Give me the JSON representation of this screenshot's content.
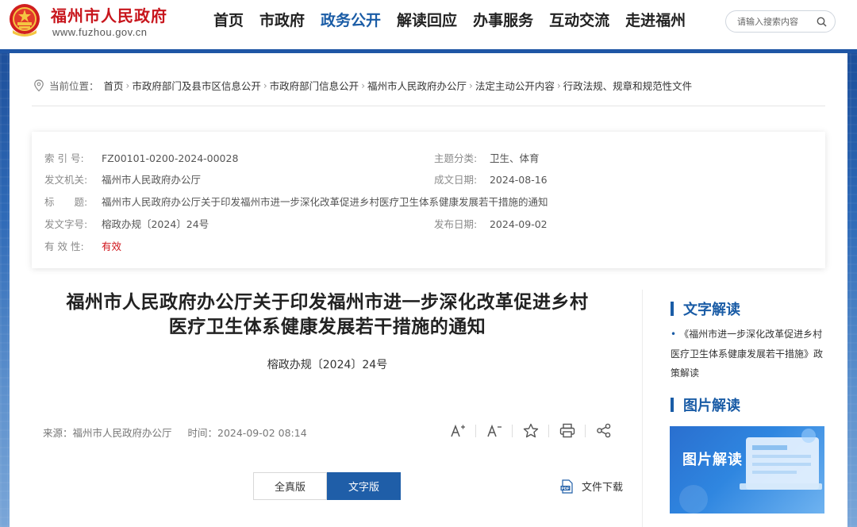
{
  "header": {
    "site_name": "福州市人民政府",
    "site_url": "www.fuzhou.gov.cn",
    "nav": [
      "首页",
      "市政府",
      "政务公开",
      "解读回应",
      "办事服务",
      "互动交流",
      "走进福州"
    ],
    "active_nav": "政务公开",
    "search_placeholder": "请输入搜索内容"
  },
  "breadcrumb": {
    "prefix": "当前位置：",
    "items": [
      "首页",
      "市政府部门及县市区信息公开",
      "市政府部门信息公开",
      "福州市人民政府办公厅",
      "法定主动公开内容",
      "行政法规、规章和规范性文件"
    ],
    "separator": "›"
  },
  "meta": {
    "index_label": "索 引 号:",
    "index_value": "FZ00101-0200-2024-00028",
    "topic_label": "主题分类:",
    "topic_value": "卫生、体育",
    "issuer_label": "发文机关:",
    "issuer_value": "福州市人民政府办公厅",
    "written_label": "成文日期:",
    "written_value": "2024-08-16",
    "title_label": "标　　题:",
    "title_value": "福州市人民政府办公厅关于印发福州市进一步深化改革促进乡村医疗卫生体系健康发展若干措施的通知",
    "docno_label": "发文字号:",
    "docno_value": "榕政办规〔2024〕24号",
    "published_label": "发布日期:",
    "published_value": "2024-09-02",
    "validity_label": "有 效 性:",
    "validity_value": "有效",
    "validity_color": "#d0141b"
  },
  "article": {
    "title_line1": "福州市人民政府办公厅关于印发福州市进一步深化改革促进乡村",
    "title_line2": "医疗卫生体系健康发展若干措施的通知",
    "doc_number": "榕政办规〔2024〕24号",
    "source": "来源：福州市人民政府办公厅",
    "time": "时间：2024-09-02 08:14",
    "tab_full": "全真版",
    "tab_text": "文字版",
    "download": "文件下载"
  },
  "sidebar": {
    "text_heading": "文字解读",
    "text_item": "《福州市进一步深化改革促进乡村医疗卫生体系健康发展若干措施》政策解读",
    "pic_heading": "图片解读",
    "pic_label": "图片解读"
  },
  "colors": {
    "brand_red": "#c8161d",
    "accent_blue": "#1a5ca6"
  },
  "icons": [
    "emblem-icon",
    "search-icon",
    "location-pin-icon",
    "font-increase-icon",
    "font-decrease-icon",
    "star-icon",
    "print-icon",
    "share-icon",
    "pdf-icon"
  ]
}
